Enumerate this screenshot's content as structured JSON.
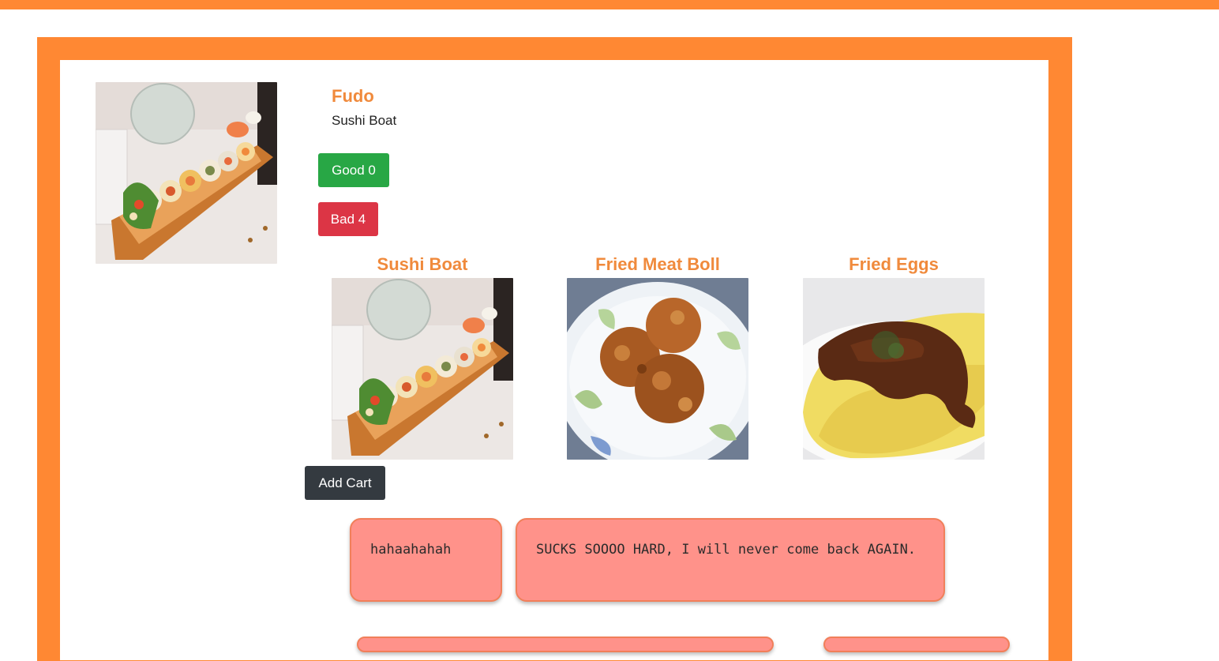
{
  "restaurant": {
    "name": "Fudo",
    "featured_dish": "Sushi Boat",
    "featured_image": "sushi-boat-photo"
  },
  "votes": {
    "good_label": "Good 0",
    "bad_label": "Bad 4"
  },
  "dishes": [
    {
      "title": "Sushi Boat",
      "image": "sushi-boat-photo"
    },
    {
      "title": "Fried Meat Boll",
      "image": "fried-meatball-photo"
    },
    {
      "title": "Fried Eggs",
      "image": "omelette-photo"
    }
  ],
  "cart": {
    "add_label": "Add Cart"
  },
  "reviews": [
    {
      "text": "hahaahahah"
    },
    {
      "text": "SUCKS SOOOO HARD, I will never come back AGAIN."
    }
  ],
  "colors": {
    "brand_orange": "#ff8833",
    "title_orange": "#f08a3c",
    "good_green": "#28a745",
    "bad_red": "#dc3545",
    "cart_dark": "#343a40",
    "review_bg": "#ff928a"
  }
}
